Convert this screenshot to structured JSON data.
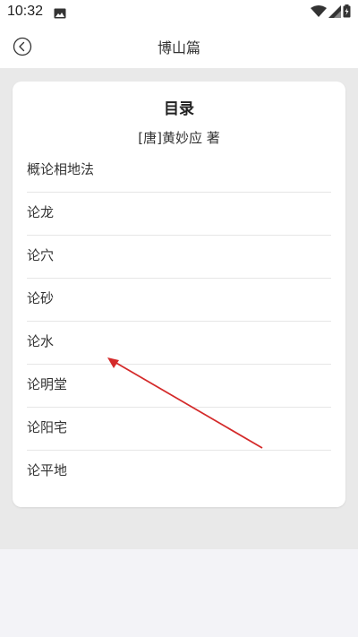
{
  "status_bar": {
    "time": "10:32",
    "icons": [
      "image-icon",
      "wifi-icon",
      "signal-icon",
      "battery-icon"
    ]
  },
  "app_bar": {
    "title": "博山篇",
    "back_icon": "back-circle-icon"
  },
  "card": {
    "title": "目录",
    "author": "[唐]黄妙应 著",
    "items": [
      {
        "label": "概论相地法"
      },
      {
        "label": "论龙"
      },
      {
        "label": "论穴"
      },
      {
        "label": "论砂"
      },
      {
        "label": "论水"
      },
      {
        "label": "论明堂"
      },
      {
        "label": "论阳宅"
      },
      {
        "label": "论平地"
      }
    ]
  },
  "colors": {
    "annotation_arrow": "#d42a2a",
    "page_bg": "#e9e9e9",
    "card_bg": "#ffffff"
  }
}
